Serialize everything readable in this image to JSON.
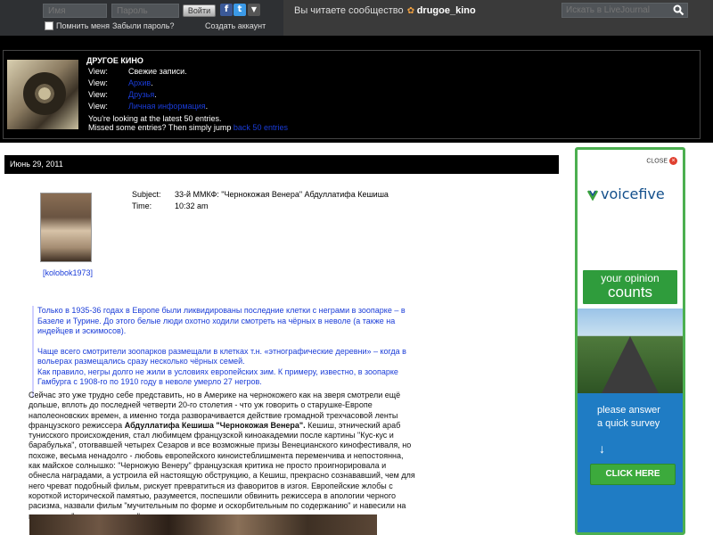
{
  "topbar": {
    "username_placeholder": "Имя",
    "password_placeholder": "Пароль",
    "login_label": "Войти",
    "remember_label": "Помнить меня",
    "forgot_label": "Забыли пароль?",
    "create_label": "Создать аккаунт",
    "reading_prefix": "Вы читаете сообщество",
    "community": "drugoe_kino",
    "search_placeholder": "Искать в LiveJournal"
  },
  "community": {
    "title": "ДРУГОЕ КИНО",
    "views": [
      {
        "label": "View:",
        "value": "Свежие записи.",
        "link": false
      },
      {
        "label": "View:",
        "value": "Архив",
        "link": true
      },
      {
        "label": "View:",
        "value": "Друзья",
        "link": true
      },
      {
        "label": "View:",
        "value": "Личная информация",
        "link": true
      }
    ],
    "latest_line": "You're looking at the latest 50 entries.",
    "missed_prefix": "Missed some entries? Then simply jump",
    "missed_link": "back 50 entries"
  },
  "entry": {
    "date": "Июнь 29, 2011",
    "poster": "[kolobok1973]",
    "subject_label": "Subject:",
    "subject": "33-й ММКФ: \"Чернокожая Венера\" Абдуллатифа Кешиша",
    "time_label": "Time:",
    "time": "10:32 am",
    "quote_paragraphs": [
      "Только в 1935-36 годах в Европе были ликвидированы последние клетки с неграми в зоопарке – в Базеле и Турине. До этого белые люди охотно ходили смотреть на чёрных в неволе (а также на индейцев и эскимосов).",
      "Чаще всего смотрители зоопарков размещали в клетках т.н. «этнографические деревни» – когда в вольерах размещались сразу несколько чёрных семей.\nКак правило, негры долго не жили в условиях европейских зим. К примеру, известно, в зоопарке Гамбурга с 1908-го по 1910 году в неволе умерло 27 негров."
    ],
    "body_before": "Сейчас это уже трудно себе представить, но в Америке на чернокожего как на зверя смотрели ещё дольше, вплоть до последней четверти 20-го столетия - что уж говорить о старушке-Европе наполеоновских времен, а именно тогда разворачивается действие громадной трехчасовой ленты французского режиссера ",
    "body_bold": "Абдуллатифа Кешиша \"Чернокожая Венера\".",
    "body_after": " Кешиш, этнический араб тунисского происхождения, стал любимцем французской киноакадемии после картины \"Кус-кус и барабулька\", отorвавшей четырех Сезаров и все возможные призы Венецианского кинофестиваля, но похоже, весьма ненадолго - любовь европейского киноистеблишмента переменчива и непостоянна, как майское солнышко: \"Черножую Венеру\" французская критика не просто проигнорировала и обнесла наградами, а устроила ей настоящую обструкцию, а Кешиш, прекрасно сознававший, чем для него чреват подобный фильм, рискует превратиться из фаворитов в изгоя. Европейские жлобы с короткой исторической памятью, разумеется, поспешили обвинить режиссера в апологии черного расизма, назвали фильм \"мучительным по форме и оскорбительным по содержанию\" и навесили на него ярлык \"кино не для всех\"."
  },
  "ad": {
    "close_label": "CLOSE",
    "brand_voice": "voice",
    "brand_five": "five",
    "sign_line1": "your opinion",
    "sign_line2": "counts",
    "cta_line1": "please answer",
    "cta_line2": "a quick survey",
    "button_label": "CLICK HERE"
  },
  "colors": {
    "link": "#1a3cd8",
    "ad_border": "#4caf50",
    "ad_blue": "#1f7cc4"
  }
}
